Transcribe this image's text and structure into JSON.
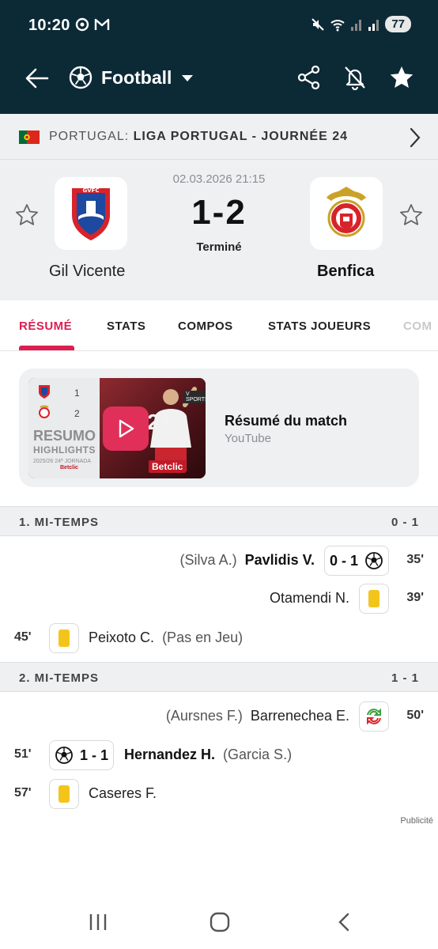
{
  "status_bar": {
    "time": "10:20",
    "battery": "77"
  },
  "app_bar": {
    "sport": "Football"
  },
  "league": {
    "country": "PORTUGAL:",
    "competition": "LIGA PORTUGAL - JOURNÉE 24"
  },
  "match": {
    "datetime": "02.03.2026 21:15",
    "score": "1-2",
    "status": "Terminé",
    "home_team": "Gil Vicente",
    "away_team": "Benfica"
  },
  "tabs": [
    "RÉSUMÉ",
    "STATS",
    "COMPOS",
    "STATS JOUEURS",
    "COM"
  ],
  "video": {
    "title": "Résumé du match",
    "source": "YouTube",
    "thumb": {
      "home_score": "1",
      "away_score": "2",
      "resumo": "RESUMO",
      "highlights": "HIGHLIGHTS",
      "season": "2025/26 24ª JORNADA",
      "jersey": "21",
      "sponsor": "Betclic",
      "sponsor_small": "Betclic",
      "channel": "V SPORTS"
    }
  },
  "sections": [
    {
      "title": "1. MI-TEMPS",
      "score": "0 - 1",
      "events": [
        {
          "assist": "(Silva A.)",
          "player": "Pavlidis V.",
          "score": "0 - 1",
          "minute": "35'"
        },
        {
          "player": "Otamendi N.",
          "minute": "39'"
        },
        {
          "minute": "45'",
          "player": "Peixoto C.",
          "detail": "(Pas en Jeu)"
        }
      ]
    },
    {
      "title": "2. MI-TEMPS",
      "score": "1 - 1",
      "events": [
        {
          "assist": "(Aursnes F.)",
          "player": "Barrenechea E.",
          "minute": "50'"
        },
        {
          "minute": "51'",
          "score": "1 - 1",
          "player": "Hernandez H.",
          "assist": "(Garcia S.)"
        },
        {
          "minute": "57'",
          "player": "Caseres F."
        }
      ]
    }
  ],
  "ad_label": "Publicité",
  "colors": {
    "header_bg": "#0c2a36",
    "accent": "#dd1e50",
    "yellow_card": "#f3c51b"
  },
  "icons": [
    "back-arrow-icon",
    "soccer-ball-icon",
    "dropdown-caret-icon",
    "share-icon",
    "bell-off-icon",
    "star-icon",
    "chevron-right-icon",
    "play-icon",
    "substitution-icon",
    "yellow-card-icon"
  ]
}
